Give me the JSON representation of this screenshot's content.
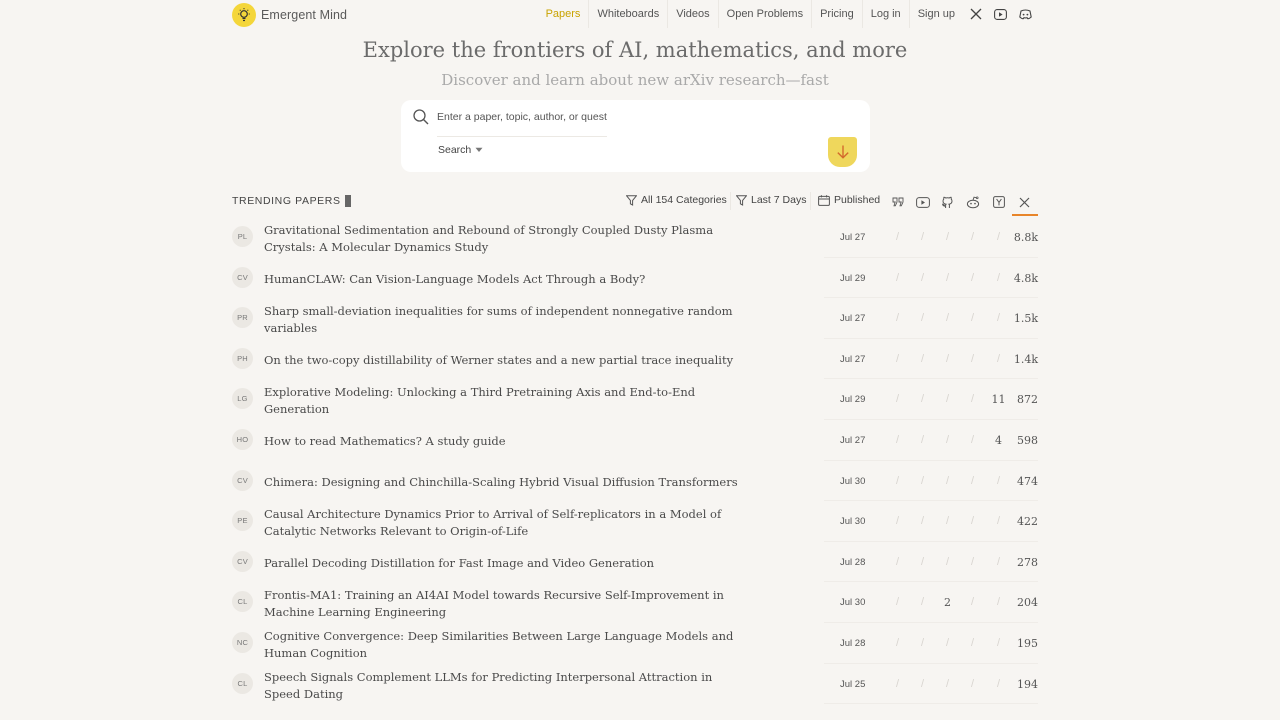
{
  "brand": {
    "name": "Emergent Mind",
    "logo_icon": "lightbulb-icon"
  },
  "nav": {
    "items": [
      {
        "label": "Papers",
        "active": true
      },
      {
        "label": "Whiteboards"
      },
      {
        "label": "Videos"
      },
      {
        "label": "Open Problems"
      },
      {
        "label": "Pricing"
      },
      {
        "label": "Log in"
      },
      {
        "label": "Sign up"
      }
    ],
    "social_icons": [
      "x-icon",
      "youtube-icon",
      "discord-icon"
    ]
  },
  "hero": {
    "title": "Explore the frontiers of AI, mathematics, and more",
    "subtitle": "Discover and learn about new arXiv research—fast"
  },
  "search": {
    "placeholder": "Enter a paper, topic, author, or question",
    "value": "",
    "mode_label": "Search"
  },
  "trending": {
    "heading": "TRENDING PAPERS",
    "filters": {
      "categories": "All 154 Categories",
      "range": "Last 7 Days",
      "date_mode": "Published"
    },
    "sort_icons": [
      "quote-icon",
      "youtube-icon",
      "github-icon",
      "reddit-icon",
      "hackernews-icon",
      "x-icon"
    ],
    "active_sort": "x-icon",
    "papers": [
      {
        "cat": "PL",
        "title": "Gravitational Sedimentation and Rebound of Strongly Coupled Dusty Plasma Crystals: A Molecular Dynamics Study",
        "date": "Jul 27",
        "metrics": [
          "/",
          "/",
          "/",
          "/",
          "/"
        ],
        "score": "8.8k"
      },
      {
        "cat": "CV",
        "title": "HumanCLAW: Can Vision-Language Models Act Through a Body?",
        "date": "Jul 29",
        "metrics": [
          "/",
          "/",
          "/",
          "/",
          "/"
        ],
        "score": "4.8k"
      },
      {
        "cat": "PR",
        "title": "Sharp small-deviation inequalities for sums of independent nonnegative random variables",
        "date": "Jul 27",
        "metrics": [
          "/",
          "/",
          "/",
          "/",
          "/"
        ],
        "score": "1.5k"
      },
      {
        "cat": "PH",
        "title": "On the two-copy distillability of Werner states and a new partial trace inequality",
        "date": "Jul 27",
        "metrics": [
          "/",
          "/",
          "/",
          "/",
          "/"
        ],
        "score": "1.4k"
      },
      {
        "cat": "LG",
        "title": "Explorative Modeling: Unlocking a Third Pretraining Axis and End-to-End Generation",
        "date": "Jul 29",
        "metrics": [
          "/",
          "/",
          "/",
          "/",
          "11"
        ],
        "score": "872"
      },
      {
        "cat": "HO",
        "title": "How to read Mathematics? A study guide",
        "date": "Jul 27",
        "metrics": [
          "/",
          "/",
          "/",
          "/",
          "4"
        ],
        "score": "598"
      },
      {
        "cat": "CV",
        "title": "Chimera: Designing and Chinchilla-Scaling Hybrid Visual Diffusion Transformers",
        "date": "Jul 30",
        "metrics": [
          "/",
          "/",
          "/",
          "/",
          "/"
        ],
        "score": "474"
      },
      {
        "cat": "PE",
        "title": "Causal Architecture Dynamics Prior to Arrival of Self-replicators in a Model of Catalytic Networks Relevant to Origin-of-Life",
        "date": "Jul 30",
        "metrics": [
          "/",
          "/",
          "/",
          "/",
          "/"
        ],
        "score": "422"
      },
      {
        "cat": "CV",
        "title": "Parallel Decoding Distillation for Fast Image and Video Generation",
        "date": "Jul 28",
        "metrics": [
          "/",
          "/",
          "/",
          "/",
          "/"
        ],
        "score": "278"
      },
      {
        "cat": "CL",
        "title": "Frontis-MA1: Training an AI4AI Model towards Recursive Self-Improvement in Machine Learning Engineering",
        "date": "Jul 30",
        "metrics": [
          "/",
          "/",
          "2",
          "/",
          "/"
        ],
        "score": "204"
      },
      {
        "cat": "NC",
        "title": "Cognitive Convergence: Deep Similarities Between Large Language Models and Human Cognition",
        "date": "Jul 28",
        "metrics": [
          "/",
          "/",
          "/",
          "/",
          "/"
        ],
        "score": "195"
      },
      {
        "cat": "CL",
        "title": "Speech Signals Complement LLMs for Predicting Interpersonal Attraction in Speed Dating",
        "date": "Jul 25",
        "metrics": [
          "/",
          "/",
          "/",
          "/",
          "/"
        ],
        "score": "194"
      }
    ]
  },
  "colors": {
    "accent": "#c9a300",
    "logo": "#f4d63a",
    "search_button": "#efd75c",
    "sort_underline": "#e8852a"
  }
}
